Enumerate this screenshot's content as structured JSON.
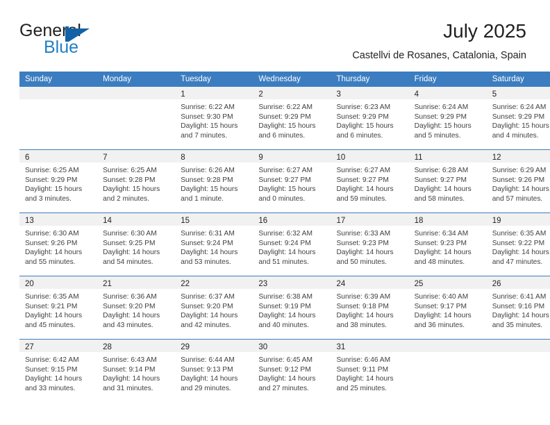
{
  "brand": {
    "name_top": "General",
    "name_bottom": "Blue",
    "mark": "triangle-logo",
    "color_dark": "#231f20",
    "color_blue": "#1f7fc4",
    "mark_color": "#1362a8"
  },
  "header": {
    "title": "July 2025",
    "subtitle": "Castellvi de Rosanes, Catalonia, Spain"
  },
  "theme": {
    "header_bg": "#3b7dc0",
    "header_text": "#ffffff",
    "daynum_band_bg": "#f1f1f1",
    "row_divider": "#3b7dc0",
    "cell_bg": "#ffffff",
    "body_text": "#404040"
  },
  "weekdays": [
    "Sunday",
    "Monday",
    "Tuesday",
    "Wednesday",
    "Thursday",
    "Friday",
    "Saturday"
  ],
  "weeks": [
    [
      {
        "day": ""
      },
      {
        "day": ""
      },
      {
        "day": "1",
        "sunrise": "Sunrise: 6:22 AM",
        "sunset": "Sunset: 9:30 PM",
        "daylight1": "Daylight: 15 hours",
        "daylight2": "and 7 minutes."
      },
      {
        "day": "2",
        "sunrise": "Sunrise: 6:22 AM",
        "sunset": "Sunset: 9:29 PM",
        "daylight1": "Daylight: 15 hours",
        "daylight2": "and 6 minutes."
      },
      {
        "day": "3",
        "sunrise": "Sunrise: 6:23 AM",
        "sunset": "Sunset: 9:29 PM",
        "daylight1": "Daylight: 15 hours",
        "daylight2": "and 6 minutes."
      },
      {
        "day": "4",
        "sunrise": "Sunrise: 6:24 AM",
        "sunset": "Sunset: 9:29 PM",
        "daylight1": "Daylight: 15 hours",
        "daylight2": "and 5 minutes."
      },
      {
        "day": "5",
        "sunrise": "Sunrise: 6:24 AM",
        "sunset": "Sunset: 9:29 PM",
        "daylight1": "Daylight: 15 hours",
        "daylight2": "and 4 minutes."
      }
    ],
    [
      {
        "day": "6",
        "sunrise": "Sunrise: 6:25 AM",
        "sunset": "Sunset: 9:29 PM",
        "daylight1": "Daylight: 15 hours",
        "daylight2": "and 3 minutes."
      },
      {
        "day": "7",
        "sunrise": "Sunrise: 6:25 AM",
        "sunset": "Sunset: 9:28 PM",
        "daylight1": "Daylight: 15 hours",
        "daylight2": "and 2 minutes."
      },
      {
        "day": "8",
        "sunrise": "Sunrise: 6:26 AM",
        "sunset": "Sunset: 9:28 PM",
        "daylight1": "Daylight: 15 hours",
        "daylight2": "and 1 minute."
      },
      {
        "day": "9",
        "sunrise": "Sunrise: 6:27 AM",
        "sunset": "Sunset: 9:27 PM",
        "daylight1": "Daylight: 15 hours",
        "daylight2": "and 0 minutes."
      },
      {
        "day": "10",
        "sunrise": "Sunrise: 6:27 AM",
        "sunset": "Sunset: 9:27 PM",
        "daylight1": "Daylight: 14 hours",
        "daylight2": "and 59 minutes."
      },
      {
        "day": "11",
        "sunrise": "Sunrise: 6:28 AM",
        "sunset": "Sunset: 9:27 PM",
        "daylight1": "Daylight: 14 hours",
        "daylight2": "and 58 minutes."
      },
      {
        "day": "12",
        "sunrise": "Sunrise: 6:29 AM",
        "sunset": "Sunset: 9:26 PM",
        "daylight1": "Daylight: 14 hours",
        "daylight2": "and 57 minutes."
      }
    ],
    [
      {
        "day": "13",
        "sunrise": "Sunrise: 6:30 AM",
        "sunset": "Sunset: 9:26 PM",
        "daylight1": "Daylight: 14 hours",
        "daylight2": "and 55 minutes."
      },
      {
        "day": "14",
        "sunrise": "Sunrise: 6:30 AM",
        "sunset": "Sunset: 9:25 PM",
        "daylight1": "Daylight: 14 hours",
        "daylight2": "and 54 minutes."
      },
      {
        "day": "15",
        "sunrise": "Sunrise: 6:31 AM",
        "sunset": "Sunset: 9:24 PM",
        "daylight1": "Daylight: 14 hours",
        "daylight2": "and 53 minutes."
      },
      {
        "day": "16",
        "sunrise": "Sunrise: 6:32 AM",
        "sunset": "Sunset: 9:24 PM",
        "daylight1": "Daylight: 14 hours",
        "daylight2": "and 51 minutes."
      },
      {
        "day": "17",
        "sunrise": "Sunrise: 6:33 AM",
        "sunset": "Sunset: 9:23 PM",
        "daylight1": "Daylight: 14 hours",
        "daylight2": "and 50 minutes."
      },
      {
        "day": "18",
        "sunrise": "Sunrise: 6:34 AM",
        "sunset": "Sunset: 9:23 PM",
        "daylight1": "Daylight: 14 hours",
        "daylight2": "and 48 minutes."
      },
      {
        "day": "19",
        "sunrise": "Sunrise: 6:35 AM",
        "sunset": "Sunset: 9:22 PM",
        "daylight1": "Daylight: 14 hours",
        "daylight2": "and 47 minutes."
      }
    ],
    [
      {
        "day": "20",
        "sunrise": "Sunrise: 6:35 AM",
        "sunset": "Sunset: 9:21 PM",
        "daylight1": "Daylight: 14 hours",
        "daylight2": "and 45 minutes."
      },
      {
        "day": "21",
        "sunrise": "Sunrise: 6:36 AM",
        "sunset": "Sunset: 9:20 PM",
        "daylight1": "Daylight: 14 hours",
        "daylight2": "and 43 minutes."
      },
      {
        "day": "22",
        "sunrise": "Sunrise: 6:37 AM",
        "sunset": "Sunset: 9:20 PM",
        "daylight1": "Daylight: 14 hours",
        "daylight2": "and 42 minutes."
      },
      {
        "day": "23",
        "sunrise": "Sunrise: 6:38 AM",
        "sunset": "Sunset: 9:19 PM",
        "daylight1": "Daylight: 14 hours",
        "daylight2": "and 40 minutes."
      },
      {
        "day": "24",
        "sunrise": "Sunrise: 6:39 AM",
        "sunset": "Sunset: 9:18 PM",
        "daylight1": "Daylight: 14 hours",
        "daylight2": "and 38 minutes."
      },
      {
        "day": "25",
        "sunrise": "Sunrise: 6:40 AM",
        "sunset": "Sunset: 9:17 PM",
        "daylight1": "Daylight: 14 hours",
        "daylight2": "and 36 minutes."
      },
      {
        "day": "26",
        "sunrise": "Sunrise: 6:41 AM",
        "sunset": "Sunset: 9:16 PM",
        "daylight1": "Daylight: 14 hours",
        "daylight2": "and 35 minutes."
      }
    ],
    [
      {
        "day": "27",
        "sunrise": "Sunrise: 6:42 AM",
        "sunset": "Sunset: 9:15 PM",
        "daylight1": "Daylight: 14 hours",
        "daylight2": "and 33 minutes."
      },
      {
        "day": "28",
        "sunrise": "Sunrise: 6:43 AM",
        "sunset": "Sunset: 9:14 PM",
        "daylight1": "Daylight: 14 hours",
        "daylight2": "and 31 minutes."
      },
      {
        "day": "29",
        "sunrise": "Sunrise: 6:44 AM",
        "sunset": "Sunset: 9:13 PM",
        "daylight1": "Daylight: 14 hours",
        "daylight2": "and 29 minutes."
      },
      {
        "day": "30",
        "sunrise": "Sunrise: 6:45 AM",
        "sunset": "Sunset: 9:12 PM",
        "daylight1": "Daylight: 14 hours",
        "daylight2": "and 27 minutes."
      },
      {
        "day": "31",
        "sunrise": "Sunrise: 6:46 AM",
        "sunset": "Sunset: 9:11 PM",
        "daylight1": "Daylight: 14 hours",
        "daylight2": "and 25 minutes."
      },
      {
        "day": ""
      },
      {
        "day": ""
      }
    ]
  ]
}
